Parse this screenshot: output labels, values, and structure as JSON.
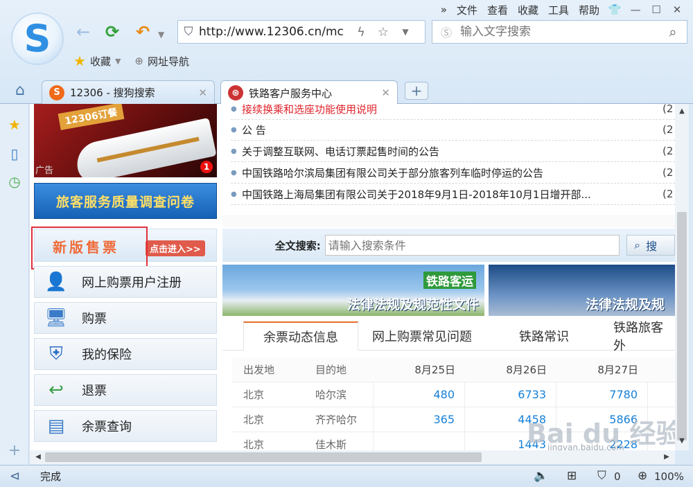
{
  "browser": {
    "logo_letter": "S",
    "menu": [
      "文件",
      "查看",
      "收藏",
      "工具",
      "帮助"
    ],
    "menu_more": "»",
    "window_controls": {
      "skin": "👕",
      "minimize": "—",
      "maximize": "☐",
      "close": "✕"
    },
    "address": {
      "url": "http://www.12306.cn/mc"
    },
    "search": {
      "placeholder": "输入文字搜索"
    },
    "favorites": {
      "label": "收藏",
      "nav_label": "网址导航"
    },
    "tabs": [
      {
        "label": "12306 - 搜狗搜索",
        "icon": "sogou-icon",
        "active": false
      },
      {
        "label": "铁路客户服务中心",
        "icon": "railway-logo-icon",
        "active": true
      }
    ],
    "status": {
      "text": "完成",
      "shield_count": "0",
      "zoom": "100%"
    }
  },
  "page": {
    "ad": {
      "tag": "12306订餐",
      "label": "广告",
      "badge": "1"
    },
    "survey_label": "旅客服务质量调查问卷",
    "new_sale": {
      "title": "新版售票",
      "enter": "点击进入>>"
    },
    "menu_items": [
      {
        "label": "网上购票用户注册",
        "icon": "user-register-icon"
      },
      {
        "label": "购票",
        "icon": "ticket-computer-icon"
      },
      {
        "label": "我的保险",
        "icon": "insurance-shield-icon"
      },
      {
        "label": "退票",
        "icon": "refund-arrow-icon"
      },
      {
        "label": "余票查询",
        "icon": "ticket-query-icon"
      }
    ],
    "news": [
      {
        "title": "接续换乘和选座功能使用说明",
        "date": "(2",
        "highlight": true
      },
      {
        "title": "公 告",
        "date": "(2",
        "highlight": false
      },
      {
        "title": "关于调整互联网、电话订票起售时间的公告",
        "date": "(2",
        "highlight": false
      },
      {
        "title": "中国铁路哈尔滨局集团有限公司关于部分旅客列车临时停运的公告",
        "date": "(2",
        "highlight": false
      },
      {
        "title": "中国铁路上海局集团有限公司关于2018年9月1日-2018年10月1日增开部...",
        "date": "(2",
        "highlight": false
      }
    ],
    "fulltext_search": {
      "label": "全文搜索:",
      "placeholder": "请输入搜索条件",
      "button": "搜"
    },
    "banners": [
      {
        "tag": "铁路客运",
        "text": "法律法规及规范性文件"
      },
      {
        "text": "法律法规及规"
      }
    ],
    "info_tabs": [
      "余票动态信息",
      "网上购票常见问题",
      "铁路常识",
      "铁路旅客外"
    ],
    "ticket_table": {
      "headers": [
        "出发地",
        "目的地",
        "8月25日",
        "8月26日",
        "8月27日"
      ],
      "rows": [
        {
          "from": "北京",
          "to": "哈尔滨",
          "v": [
            "480",
            "6733",
            "7780"
          ]
        },
        {
          "from": "北京",
          "to": "齐齐哈尔",
          "v": [
            "365",
            "4458",
            "5866"
          ]
        },
        {
          "from": "北京",
          "to": "佳木斯",
          "v": [
            "",
            "1443",
            "2228"
          ]
        }
      ]
    },
    "watermark": {
      "main": "Bai du 经验",
      "sub": "jingyan.baidu.com"
    }
  }
}
